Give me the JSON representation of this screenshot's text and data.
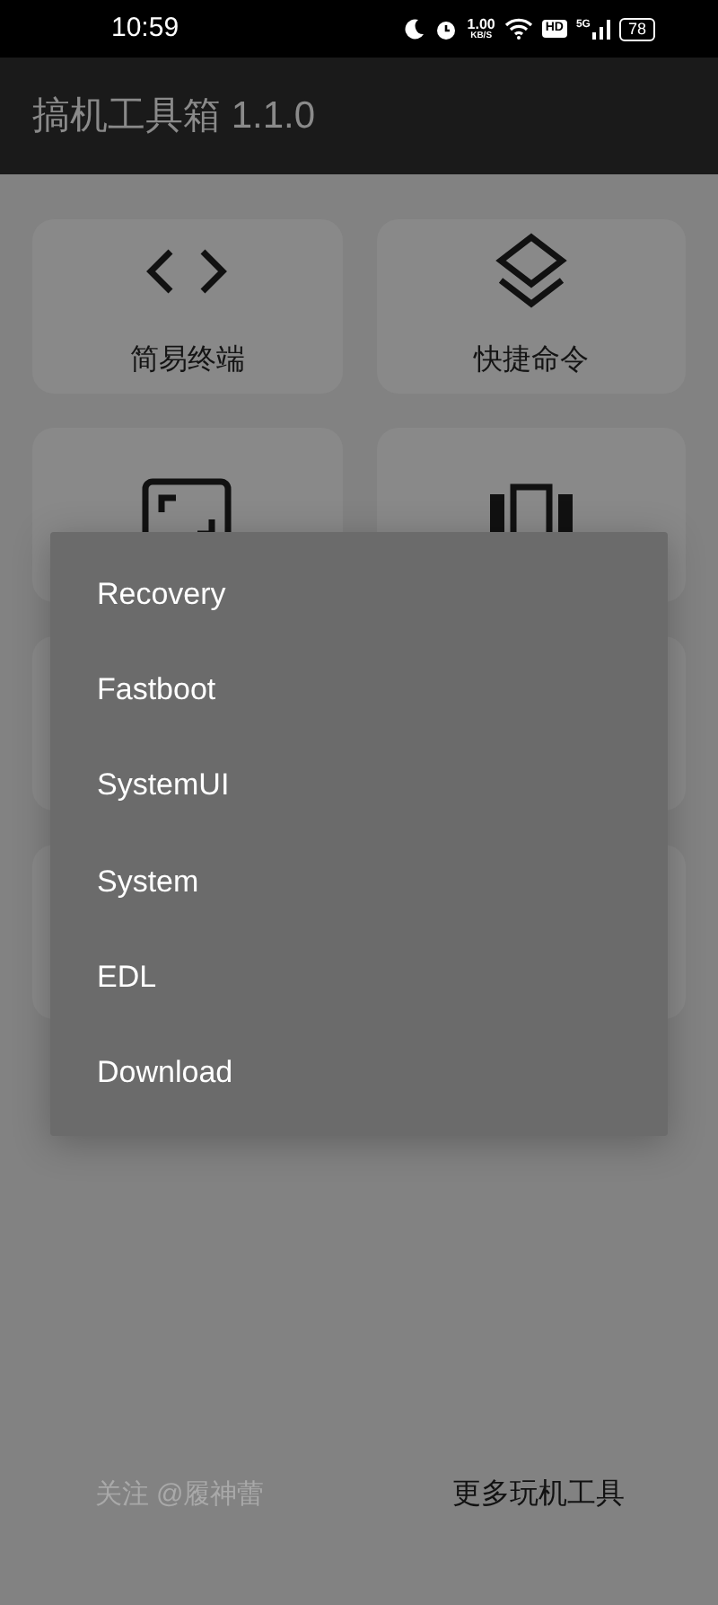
{
  "status_bar": {
    "time": "10:59",
    "speed_value": "1.00",
    "speed_unit": "KB/S",
    "hd": "HD",
    "network": "5G",
    "battery": "78"
  },
  "app_bar": {
    "title": "搞机工具箱 1.1.0"
  },
  "tiles": [
    {
      "kind": "code",
      "label": "简易终端"
    },
    {
      "kind": "layers",
      "label": "快捷命令"
    },
    {
      "kind": "frame"
    },
    {
      "kind": "carousel"
    },
    {
      "kind": "blank"
    },
    {
      "kind": "blank"
    },
    {
      "kind": "blank"
    },
    {
      "kind": "blank"
    }
  ],
  "menu": {
    "items": [
      "Recovery",
      "Fastboot",
      "SystemUI",
      "System",
      "EDL",
      "Download"
    ]
  },
  "footer": {
    "follow": "关注 @履神蕾",
    "more_tools": "更多玩机工具"
  }
}
